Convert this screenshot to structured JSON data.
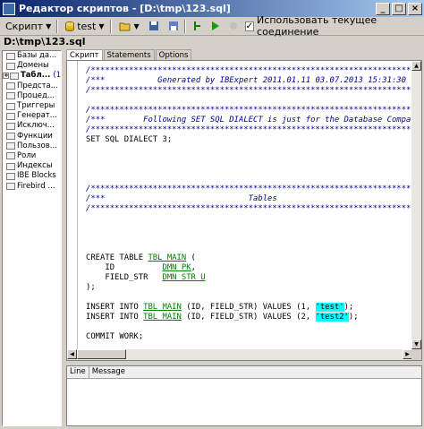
{
  "window": {
    "title": "Редактор скриптов - [D:\\tmp\\123.sql]"
  },
  "toolbar": {
    "script_label": "Скрипт",
    "connection_label": "test",
    "use_connection_label": "Использовать текущее соединение",
    "use_connection_checked": true
  },
  "file": {
    "path": "D:\\tmp\\123.sql"
  },
  "tree": {
    "items": [
      {
        "label": "Базы да..."
      },
      {
        "label": "Домены"
      },
      {
        "label": "Табл...",
        "count": "(1)",
        "expanded": false,
        "bold": true
      },
      {
        "label": "Предста..."
      },
      {
        "label": "Процед..."
      },
      {
        "label": "Триггеры"
      },
      {
        "label": "Генерат..."
      },
      {
        "label": "Исключ..."
      },
      {
        "label": "Функции"
      },
      {
        "label": "Пользов..."
      },
      {
        "label": "Роли"
      },
      {
        "label": "Индексы"
      },
      {
        "label": "IBE Blocks"
      },
      {
        "label": "Firebird ..."
      }
    ]
  },
  "tabs": [
    {
      "label": "Скрипт",
      "active": true
    },
    {
      "label": "Statements",
      "active": false
    },
    {
      "label": "Options",
      "active": false
    }
  ],
  "editor": {
    "lines": [
      {
        "segs": [
          {
            "t": "cm",
            "v": "/******************************************************************************"
          }
        ]
      },
      {
        "segs": [
          {
            "t": "cm",
            "v": "/***           Generated by IBExpert 2011.01.11 03.07.2013 15:31:30"
          }
        ]
      },
      {
        "segs": [
          {
            "t": "cm",
            "v": "/******************************************************************************"
          }
        ]
      },
      {
        "segs": []
      },
      {
        "segs": [
          {
            "t": "cm",
            "v": "/******************************************************************************"
          }
        ]
      },
      {
        "segs": [
          {
            "t": "cm",
            "v": "/***        Following SET SQL DIALECT is just for the Database Compa"
          }
        ]
      },
      {
        "segs": [
          {
            "t": "cm",
            "v": "/******************************************************************************"
          }
        ]
      },
      {
        "segs": [
          {
            "t": "kw",
            "v": "SET SQL DIALECT 3;"
          }
        ]
      },
      {
        "segs": []
      },
      {
        "segs": []
      },
      {
        "segs": []
      },
      {
        "segs": []
      },
      {
        "segs": [
          {
            "t": "cm",
            "v": "/******************************************************************************"
          }
        ]
      },
      {
        "segs": [
          {
            "t": "cm",
            "v": "/***                              Tables"
          }
        ]
      },
      {
        "segs": [
          {
            "t": "cm",
            "v": "/******************************************************************************"
          }
        ]
      },
      {
        "segs": []
      },
      {
        "segs": []
      },
      {
        "segs": []
      },
      {
        "segs": []
      },
      {
        "segs": [
          {
            "t": "kw",
            "v": "CREATE TABLE "
          },
          {
            "t": "id",
            "v": "TBL_MAIN"
          },
          {
            "t": "kw",
            "v": " ("
          }
        ]
      },
      {
        "segs": [
          {
            "t": "kw",
            "v": "    ID          "
          },
          {
            "t": "id",
            "v": "DMN_PK"
          },
          {
            "t": "kw",
            "v": ","
          }
        ]
      },
      {
        "segs": [
          {
            "t": "kw",
            "v": "    FIELD_STR   "
          },
          {
            "t": "id",
            "v": "DMN_STR_U"
          }
        ]
      },
      {
        "segs": [
          {
            "t": "kw",
            "v": ");"
          }
        ]
      },
      {
        "segs": []
      },
      {
        "segs": [
          {
            "t": "kw",
            "v": "INSERT INTO "
          },
          {
            "t": "id",
            "v": "TBL_MAIN"
          },
          {
            "t": "kw",
            "v": " (ID, FIELD_STR) VALUES (1, "
          },
          {
            "t": "str",
            "v": "'test'"
          },
          {
            "t": "kw",
            "v": ");"
          }
        ]
      },
      {
        "segs": [
          {
            "t": "kw",
            "v": "INSERT INTO "
          },
          {
            "t": "id",
            "v": "TBL_MAIN"
          },
          {
            "t": "kw",
            "v": " (ID, FIELD_STR) VALUES (2, "
          },
          {
            "t": "str",
            "v": "'test2'"
          },
          {
            "t": "kw",
            "v": ");"
          }
        ]
      },
      {
        "segs": []
      },
      {
        "segs": [
          {
            "t": "kw",
            "v": "COMMIT WORK;"
          }
        ]
      }
    ]
  },
  "messages": {
    "col_line": "Line",
    "col_message": "Message"
  },
  "icons": {
    "app": "editor-icon",
    "save": "floppy-icon",
    "run": "play-icon",
    "stop": "stop-icon",
    "open": "folder-icon",
    "database": "database-icon"
  }
}
